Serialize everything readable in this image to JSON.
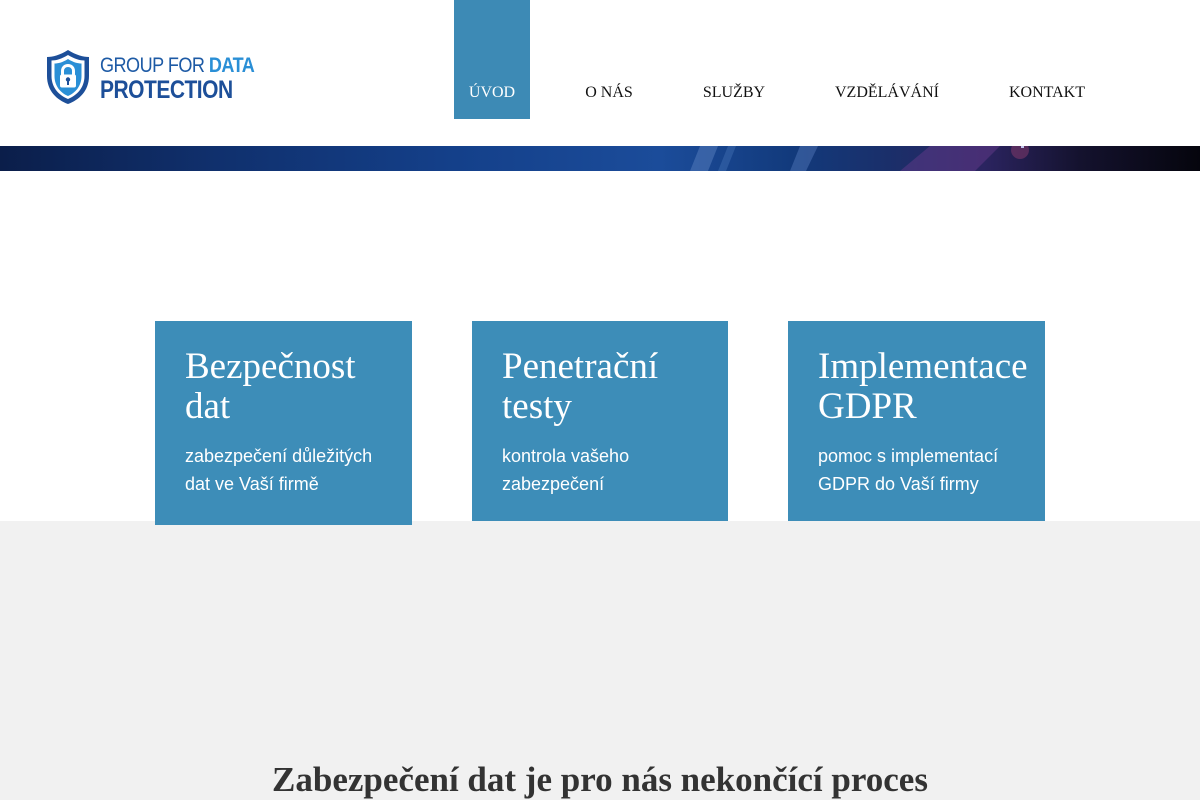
{
  "header": {
    "logo": {
      "line1_prefix": "GROUP FOR ",
      "line1_strong": "DATA",
      "line2": "PROTECTION",
      "icon": "shield-lock-icon",
      "colors": {
        "dark_blue": "#1d4f99",
        "light_blue": "#2a8fd6"
      }
    },
    "nav": [
      {
        "label": "ÚVOD",
        "active": true
      },
      {
        "label": "O NÁS",
        "active": false
      },
      {
        "label": "SLUŽBY",
        "active": false
      },
      {
        "label": "VZDĚLÁVÁNÍ",
        "active": false
      },
      {
        "label": "KONTAKT",
        "active": false
      }
    ]
  },
  "cards": [
    {
      "title": "Bezpečnost dat",
      "text": "zabezpečení důležitých dat ve Vaší firmě"
    },
    {
      "title": "Penetrační testy",
      "text": "kontrola vašeho zabezpečení"
    },
    {
      "title": "Implementace GDPR",
      "text": "pomoc s implementací GDPR do Vaší firmy"
    }
  ],
  "section": {
    "title": "Zabezpečení dat je pro nás nekončící proces"
  },
  "colors": {
    "accent": "#3d8db8",
    "nav_active": "#3d8ab5",
    "gray_background": "#f1f1f1",
    "heading_text": "#333333"
  }
}
